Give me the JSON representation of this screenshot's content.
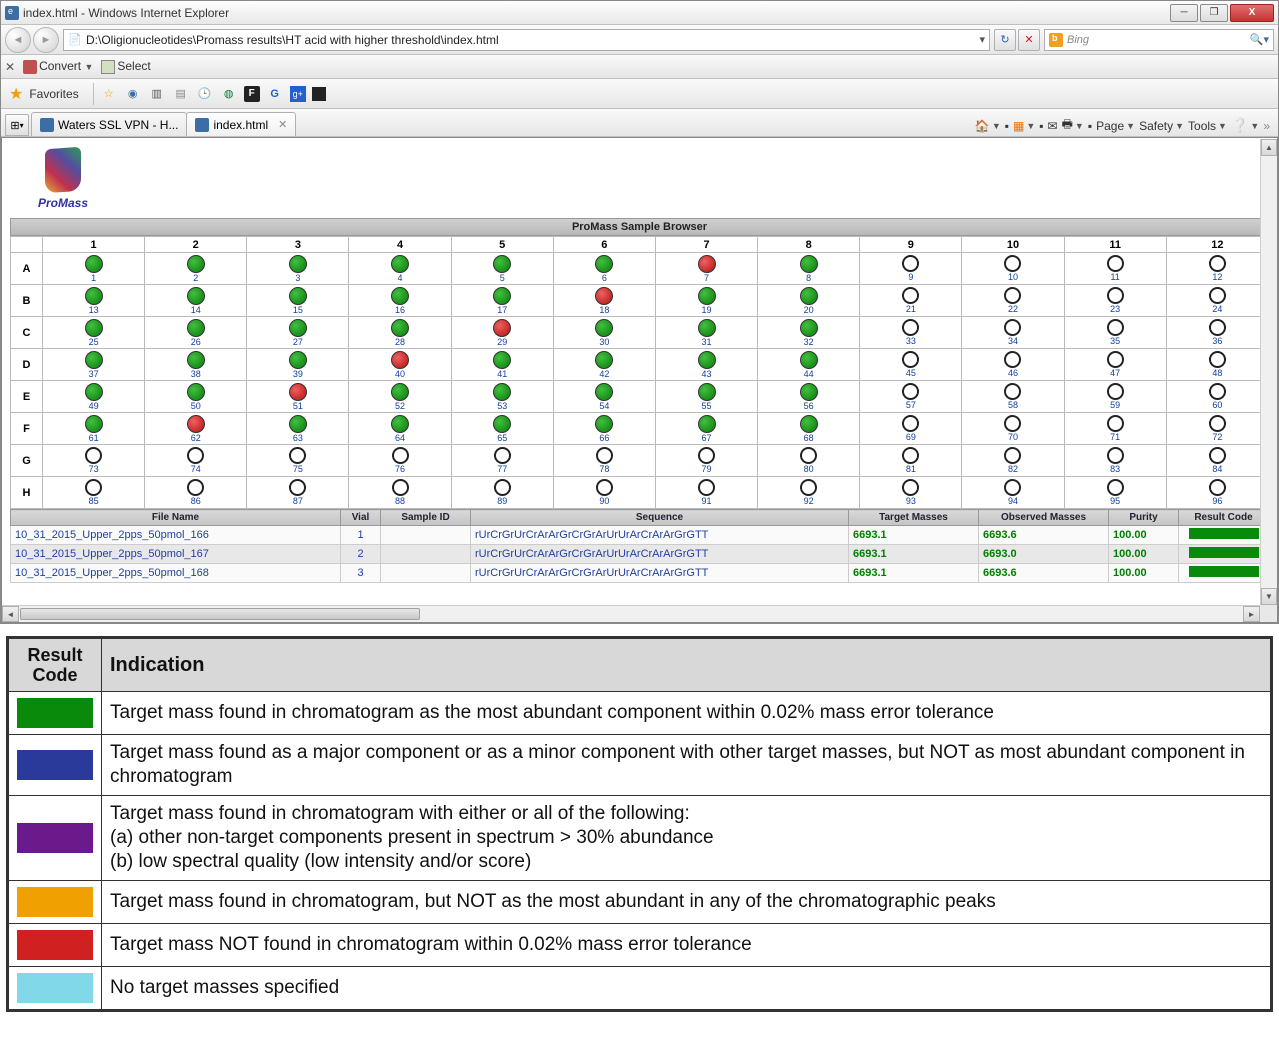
{
  "window": {
    "title": "index.html - Windows Internet Explorer",
    "close_glyph": "X"
  },
  "address_bar": {
    "url": "D:\\Oligionucleotides\\Promass results\\HT acid with higher threshold\\index.html"
  },
  "search": {
    "provider": "Bing"
  },
  "row3": {
    "convert_label": "Convert",
    "select_label": "Select"
  },
  "favorites": {
    "label": "Favorites"
  },
  "tabs": [
    {
      "label": "Waters SSL VPN - H...",
      "active": false
    },
    {
      "label": "index.html",
      "active": true
    }
  ],
  "command_bar": {
    "page": "Page",
    "safety": "Safety",
    "tools": "Tools"
  },
  "logo_text": "ProMass",
  "sample_browser_title": "ProMass Sample Browser",
  "columns": [
    "1",
    "2",
    "3",
    "4",
    "5",
    "6",
    "7",
    "8",
    "9",
    "10",
    "11",
    "12"
  ],
  "rows": [
    "A",
    "B",
    "C",
    "D",
    "E",
    "F",
    "G",
    "H"
  ],
  "wells": {
    "A": [
      {
        "n": 1,
        "s": "g"
      },
      {
        "n": 2,
        "s": "g"
      },
      {
        "n": 3,
        "s": "g"
      },
      {
        "n": 4,
        "s": "g"
      },
      {
        "n": 5,
        "s": "g"
      },
      {
        "n": 6,
        "s": "g"
      },
      {
        "n": 7,
        "s": "r"
      },
      {
        "n": 8,
        "s": "g"
      },
      {
        "n": 9,
        "s": "e"
      },
      {
        "n": 10,
        "s": "e"
      },
      {
        "n": 11,
        "s": "e"
      },
      {
        "n": 12,
        "s": "e"
      }
    ],
    "B": [
      {
        "n": 13,
        "s": "g"
      },
      {
        "n": 14,
        "s": "g"
      },
      {
        "n": 15,
        "s": "g"
      },
      {
        "n": 16,
        "s": "g"
      },
      {
        "n": 17,
        "s": "g"
      },
      {
        "n": 18,
        "s": "r"
      },
      {
        "n": 19,
        "s": "g"
      },
      {
        "n": 20,
        "s": "g"
      },
      {
        "n": 21,
        "s": "e"
      },
      {
        "n": 22,
        "s": "e"
      },
      {
        "n": 23,
        "s": "e"
      },
      {
        "n": 24,
        "s": "e"
      }
    ],
    "C": [
      {
        "n": 25,
        "s": "g"
      },
      {
        "n": 26,
        "s": "g"
      },
      {
        "n": 27,
        "s": "g"
      },
      {
        "n": 28,
        "s": "g"
      },
      {
        "n": 29,
        "s": "r"
      },
      {
        "n": 30,
        "s": "g"
      },
      {
        "n": 31,
        "s": "g"
      },
      {
        "n": 32,
        "s": "g"
      },
      {
        "n": 33,
        "s": "e"
      },
      {
        "n": 34,
        "s": "e"
      },
      {
        "n": 35,
        "s": "e"
      },
      {
        "n": 36,
        "s": "e"
      }
    ],
    "D": [
      {
        "n": 37,
        "s": "g"
      },
      {
        "n": 38,
        "s": "g"
      },
      {
        "n": 39,
        "s": "g"
      },
      {
        "n": 40,
        "s": "r"
      },
      {
        "n": 41,
        "s": "g"
      },
      {
        "n": 42,
        "s": "g"
      },
      {
        "n": 43,
        "s": "g"
      },
      {
        "n": 44,
        "s": "g"
      },
      {
        "n": 45,
        "s": "e"
      },
      {
        "n": 46,
        "s": "e"
      },
      {
        "n": 47,
        "s": "e"
      },
      {
        "n": 48,
        "s": "e"
      }
    ],
    "E": [
      {
        "n": 49,
        "s": "g"
      },
      {
        "n": 50,
        "s": "g"
      },
      {
        "n": 51,
        "s": "r"
      },
      {
        "n": 52,
        "s": "g"
      },
      {
        "n": 53,
        "s": "g"
      },
      {
        "n": 54,
        "s": "g"
      },
      {
        "n": 55,
        "s": "g"
      },
      {
        "n": 56,
        "s": "g"
      },
      {
        "n": 57,
        "s": "e"
      },
      {
        "n": 58,
        "s": "e"
      },
      {
        "n": 59,
        "s": "e"
      },
      {
        "n": 60,
        "s": "e"
      }
    ],
    "F": [
      {
        "n": 61,
        "s": "g"
      },
      {
        "n": 62,
        "s": "r"
      },
      {
        "n": 63,
        "s": "g"
      },
      {
        "n": 64,
        "s": "g"
      },
      {
        "n": 65,
        "s": "g"
      },
      {
        "n": 66,
        "s": "g"
      },
      {
        "n": 67,
        "s": "g"
      },
      {
        "n": 68,
        "s": "g"
      },
      {
        "n": 69,
        "s": "e"
      },
      {
        "n": 70,
        "s": "e"
      },
      {
        "n": 71,
        "s": "e"
      },
      {
        "n": 72,
        "s": "e"
      }
    ],
    "G": [
      {
        "n": 73,
        "s": "e"
      },
      {
        "n": 74,
        "s": "e"
      },
      {
        "n": 75,
        "s": "e"
      },
      {
        "n": 76,
        "s": "e"
      },
      {
        "n": 77,
        "s": "e"
      },
      {
        "n": 78,
        "s": "e"
      },
      {
        "n": 79,
        "s": "e"
      },
      {
        "n": 80,
        "s": "e"
      },
      {
        "n": 81,
        "s": "e"
      },
      {
        "n": 82,
        "s": "e"
      },
      {
        "n": 83,
        "s": "e"
      },
      {
        "n": 84,
        "s": "e"
      }
    ],
    "H": [
      {
        "n": 85,
        "s": "e"
      },
      {
        "n": 86,
        "s": "e"
      },
      {
        "n": 87,
        "s": "e"
      },
      {
        "n": 88,
        "s": "e"
      },
      {
        "n": 89,
        "s": "e"
      },
      {
        "n": 90,
        "s": "e"
      },
      {
        "n": 91,
        "s": "e"
      },
      {
        "n": 92,
        "s": "e"
      },
      {
        "n": 93,
        "s": "e"
      },
      {
        "n": 94,
        "s": "e"
      },
      {
        "n": 95,
        "s": "e"
      },
      {
        "n": 96,
        "s": "e"
      }
    ]
  },
  "results_headers": {
    "file_name": "File Name",
    "vial": "Vial",
    "sample_id": "Sample ID",
    "sequence": "Sequence",
    "target_masses": "Target Masses",
    "observed_masses": "Observed Masses",
    "purity": "Purity",
    "result_code": "Result Code"
  },
  "results_rows": [
    {
      "file": "10_31_2015_Upper_2pps_50pmol_166",
      "vial": "1",
      "sample_id": "",
      "sequence": "rUrCrGrUrCrArArGrCrGrArUrUrArCrArArGrGTT",
      "target": "6693.1",
      "observed": "6693.6",
      "purity": "100.00"
    },
    {
      "file": "10_31_2015_Upper_2pps_50pmol_167",
      "vial": "2",
      "sample_id": "",
      "sequence": "rUrCrGrUrCrArArGrCrGrArUrUrArCrArArGrGTT",
      "target": "6693.1",
      "observed": "6693.0",
      "purity": "100.00"
    },
    {
      "file": "10_31_2015_Upper_2pps_50pmol_168",
      "vial": "3",
      "sample_id": "",
      "sequence": "rUrCrGrUrCrArArGrCrGrArUrUrArCrArArGrGTT",
      "target": "6693.1",
      "observed": "6693.6",
      "purity": "100.00"
    }
  ],
  "legend": {
    "header_code": "Result Code",
    "header_indication": "Indication",
    "items": [
      {
        "color": "#0a8a0a",
        "text": "Target mass found in chromatogram as the most abundant component within 0.02% mass error tolerance"
      },
      {
        "color": "#2a3a9a",
        "text": "Target mass found as a major component or as a minor component with other target masses, but NOT as most abundant component in chromatogram"
      },
      {
        "color": "#6a1a8a",
        "text": "Target mass found in chromatogram with either or all of the following:\n(a) other non-target components present in spectrum > 30% abundance\n(b) low spectral quality (low intensity and/or score)"
      },
      {
        "color": "#f0a000",
        "text": "Target mass found in chromatogram, but NOT as the most abundant in any of the chromatographic peaks"
      },
      {
        "color": "#d02020",
        "text": "Target mass NOT found in chromatogram within 0.02% mass error tolerance"
      },
      {
        "color": "#80d8e8",
        "text": "No target masses specified"
      }
    ]
  }
}
